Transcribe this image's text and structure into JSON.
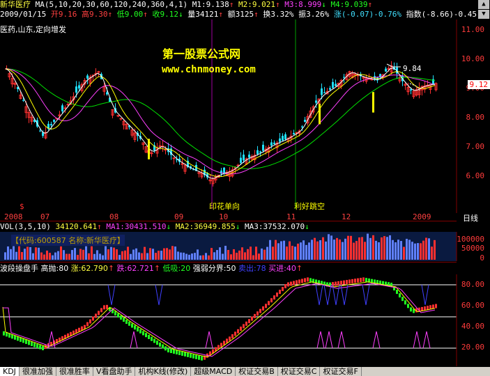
{
  "stock": {
    "name": "新华医疗",
    "ma_params": "MA(5,10,20,30,60,120,240,360,4,1)",
    "m1": "M1:9.138",
    "m2": "M2:9.021",
    "m3": "M3:8.999",
    "m4": "M4:9.039"
  },
  "quote": {
    "date": "2009/01/15",
    "open": "开9.16",
    "high": "高9.30",
    "low": "低9.00",
    "close": "收9.12",
    "volume": "量34121",
    "amount": "额3125",
    "turnover": "换3.32%",
    "amplitude": "振3.26%",
    "change": "涨(-0.07)-0.76%",
    "index": "指数(-8.66)-0.45"
  },
  "tags": "医药,山东,定向增发",
  "watermark": {
    "title": "第一股票公式网",
    "url": "www.chnmoney.com"
  },
  "annotations": {
    "peak": "9.84",
    "low_label": "印花单向",
    "mid_label": "利好跳空",
    "last_price": "9.12"
  },
  "price_axis": [
    "11.00",
    "10.00",
    "9.00",
    "8.00",
    "7.00",
    "6.00"
  ],
  "time_axis": [
    "2008",
    "07",
    "08",
    "09",
    "10",
    "11",
    "12",
    "2009",
    "日线"
  ],
  "volume": {
    "params": "VOL(3,5,10)",
    "v": "34120.641",
    "ma1": "MA1:30431.510",
    "ma2": "MA2:36949.855",
    "ma3": "MA3:37532.070",
    "banner": "【代码:600587 名称:新华医疗】",
    "axis": [
      "100000",
      "50000",
      "0"
    ]
  },
  "indicator": {
    "name": "波段操盘手",
    "high_sell": "高抛:80",
    "rise": "涨:62.790",
    "fall": "跌:62.721",
    "low_buy": "低吸:20",
    "divide": "强弱分界:50",
    "sell": "卖出:78",
    "buy": "买进:40",
    "axis": [
      "80.00",
      "60.00",
      "40.00",
      "20.00"
    ]
  },
  "tabs": [
    "KDJ",
    "很准加强",
    "很准胜率",
    "V看盘助手",
    "机构K线(修改)",
    "超级MACD",
    "权证交易B",
    "权证交易C",
    "权证交易F"
  ],
  "colors": {
    "up": "#ff3030",
    "down": "#20e0ff",
    "ma5": "#ffffff",
    "ma10": "#ffff00",
    "ma20": "#ff40ff",
    "ma30": "#00ff00"
  }
}
